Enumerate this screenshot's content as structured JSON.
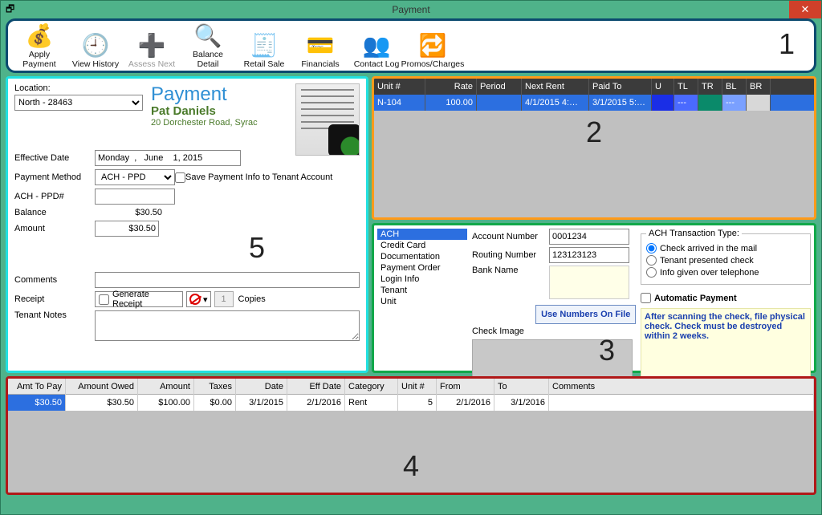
{
  "window": {
    "title": "Payment"
  },
  "toolbar": {
    "items": [
      {
        "key": "apply-payment",
        "label": "Apply Payment"
      },
      {
        "key": "view-history",
        "label": "View History"
      },
      {
        "key": "assess-next",
        "label": "Assess Next",
        "disabled": true
      },
      {
        "key": "balance-detail",
        "label": "Balance Detail"
      },
      {
        "key": "retail-sale",
        "label": "Retail Sale"
      },
      {
        "key": "financials",
        "label": "Financials"
      },
      {
        "key": "contact-log",
        "label": "Contact Log"
      },
      {
        "key": "promos-charges",
        "label": "Promos/Charges"
      }
    ],
    "zone_number": "1"
  },
  "location": {
    "label": "Location:",
    "value": "North - 28463"
  },
  "header": {
    "title": "Payment",
    "tenant_name": "Pat Daniels",
    "tenant_address": "20 Dorchester Road, Syrac"
  },
  "form": {
    "effective_date_label": "Effective Date",
    "effective_date_value": "Monday  ,   June    1, 2015",
    "payment_method_label": "Payment Method",
    "payment_method_value": "ACH - PPD",
    "save_info_label": "Save Payment Info to Tenant Account",
    "ach_ppd_label": "ACH - PPD#",
    "ach_ppd_value": "",
    "balance_label": "Balance",
    "balance_value": "$30.50",
    "amount_label": "Amount",
    "amount_value": "$30.50",
    "comments_label": "Comments",
    "comments_value": "",
    "receipt_label": "Receipt",
    "generate_receipt_label": "Generate Receipt",
    "copies_label": "Copies",
    "copies_value": "1",
    "tenant_notes_label": "Tenant Notes",
    "tenant_notes_value": "",
    "zone_number": "5"
  },
  "units_grid": {
    "headers": {
      "unit": "Unit #",
      "rate": "Rate",
      "period": "Period",
      "next_rent": "Next Rent",
      "paid_to": "Paid To",
      "u": "U",
      "tl": "TL",
      "tr": "TR",
      "bl": "BL",
      "br": "BR"
    },
    "row": {
      "unit": "N-104",
      "rate": "100.00",
      "period": "",
      "next_rent": "4/1/2015 4:…",
      "paid_to": "3/1/2015 5:…",
      "tl": "---",
      "tr": "",
      "bl": "---",
      "br": ""
    },
    "zone_number": "2"
  },
  "ach": {
    "side_items": [
      "ACH",
      "Credit Card",
      "Documentation",
      "Payment Order",
      "Login Info",
      "Tenant",
      "Unit"
    ],
    "account_label": "Account Number",
    "account_value": "0001234",
    "routing_label": "Routing Number",
    "routing_value": "123123123",
    "bank_label": "Bank Name",
    "bank_value": "",
    "use_button": "Use Numbers On File",
    "check_image_label": "Check Image",
    "type_legend": "ACH Transaction Type:",
    "type_options": [
      "Check arrived in the mail",
      "Tenant presented check",
      "Info given over telephone"
    ],
    "auto_label": "Automatic Payment",
    "note": "After scanning the check, file physical check.  Check must be destroyed within 2 weeks.",
    "zone_number": "3"
  },
  "ledger": {
    "headers": {
      "amt_to_pay": "Amt To Pay",
      "amount_owed": "Amount Owed",
      "amount": "Amount",
      "taxes": "Taxes",
      "date": "Date",
      "eff_date": "Eff Date",
      "category": "Category",
      "unit": "Unit #",
      "from": "From",
      "to": "To",
      "comments": "Comments"
    },
    "row": {
      "amt_to_pay": "$30.50",
      "amount_owed": "$30.50",
      "amount": "$100.00",
      "taxes": "$0.00",
      "date": "3/1/2015",
      "eff_date": "2/1/2016",
      "category": "Rent",
      "unit": "5",
      "from": "2/1/2016",
      "to": "3/1/2016",
      "comments": ""
    },
    "zone_number": "4"
  }
}
